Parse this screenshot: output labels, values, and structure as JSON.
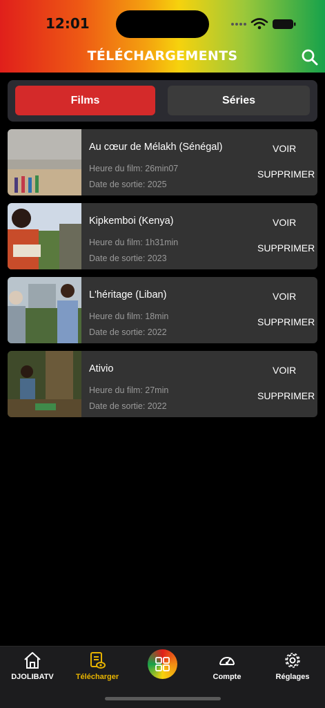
{
  "status": {
    "time": "12:01"
  },
  "header": {
    "title": "TÉLÉCHARGEMENTS"
  },
  "segments": {
    "films": "Films",
    "series": "Séries"
  },
  "movies": [
    {
      "title": "Au cœur de Mélakh (Sénégal)",
      "duration": "Heure du film: 26min07",
      "release": "Date de sortie: 2025",
      "voir": "VOIR",
      "supprimer": "SUPPRIMER"
    },
    {
      "title": "Kipkemboi (Kenya)",
      "duration": "Heure du film: 1h31min",
      "release": "Date de sortie: 2023",
      "voir": "VOIR",
      "supprimer": "SUPPRIMER"
    },
    {
      "title": "L'héritage (Liban)",
      "duration": "Heure du film: 18min",
      "release": "Date de sortie: 2022",
      "voir": "VOIR",
      "supprimer": "SUPPRIMER"
    },
    {
      "title": "Ativio",
      "duration": "Heure du film: 27min",
      "release": "Date de sortie: 2022",
      "voir": "VOIR",
      "supprimer": "SUPPRIMER"
    }
  ],
  "tabbar": {
    "home": "DJOLIBATV",
    "download": "Télécharger",
    "account": "Compte",
    "settings": "Réglages"
  },
  "colors": {
    "accent_red": "#d42a2a",
    "active_tab": "#e8b400"
  }
}
